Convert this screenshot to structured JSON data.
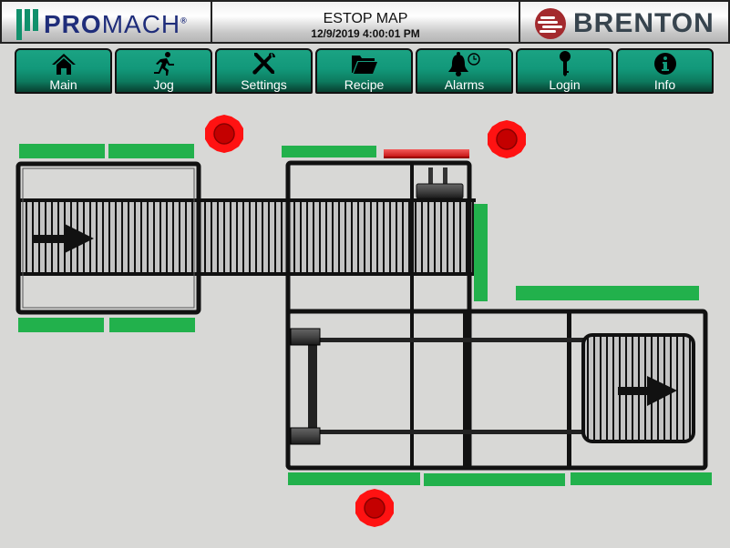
{
  "header": {
    "left_logo": {
      "text_bold": "PRO",
      "text_thin": "MACH",
      "registered": "®"
    },
    "title": "ESTOP MAP",
    "datetime": "12/9/2019 4:00:01 PM",
    "right_logo": {
      "text": "BRENTON"
    }
  },
  "nav": [
    {
      "label": "Main",
      "icon": "home-icon"
    },
    {
      "label": "Jog",
      "icon": "running-man-icon"
    },
    {
      "label": "Settings",
      "icon": "tools-icon"
    },
    {
      "label": "Recipe",
      "icon": "folder-icon"
    },
    {
      "label": "Alarms",
      "icon": "alarm-bell-icon"
    },
    {
      "label": "Login",
      "icon": "key-icon"
    },
    {
      "label": "Info",
      "icon": "info-icon"
    }
  ],
  "colors": {
    "guard_ok": "#22b14c",
    "guard_fault": "#e02020",
    "estop": "#ff1010",
    "nav_button": "#12987a",
    "background": "#d8d8d6"
  },
  "guards": [
    {
      "id": "guard-1",
      "status": "ok"
    },
    {
      "id": "guard-2",
      "status": "ok"
    },
    {
      "id": "guard-3",
      "status": "ok"
    },
    {
      "id": "guard-4",
      "status": "fault"
    },
    {
      "id": "guard-5",
      "status": "ok"
    },
    {
      "id": "guard-6",
      "status": "ok"
    },
    {
      "id": "guard-7",
      "status": "ok"
    },
    {
      "id": "guard-8",
      "status": "ok"
    },
    {
      "id": "guard-9",
      "status": "ok"
    },
    {
      "id": "guard-10",
      "status": "ok"
    },
    {
      "id": "guard-11",
      "status": "ok"
    },
    {
      "id": "guard-12",
      "status": "ok"
    }
  ],
  "estops": [
    {
      "id": "estop-1",
      "status": "active"
    },
    {
      "id": "estop-2",
      "status": "active"
    },
    {
      "id": "estop-3",
      "status": "active"
    }
  ]
}
